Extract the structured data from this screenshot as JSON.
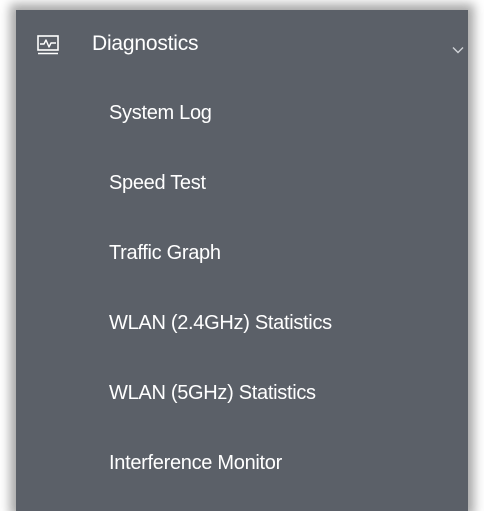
{
  "menu": {
    "header": {
      "label": "Diagnostics",
      "icon": "chart-monitor-icon",
      "expand_icon": "chevron-down-icon"
    },
    "items": [
      {
        "label": "System Log"
      },
      {
        "label": "Speed Test"
      },
      {
        "label": "Traffic Graph"
      },
      {
        "label": "WLAN (2.4GHz) Statistics"
      },
      {
        "label": "WLAN (5GHz) Statistics"
      },
      {
        "label": "Interference Monitor"
      }
    ]
  },
  "colors": {
    "panel_background": "#5b6068",
    "text": "#ffffff",
    "page_background": "#ffffff"
  }
}
